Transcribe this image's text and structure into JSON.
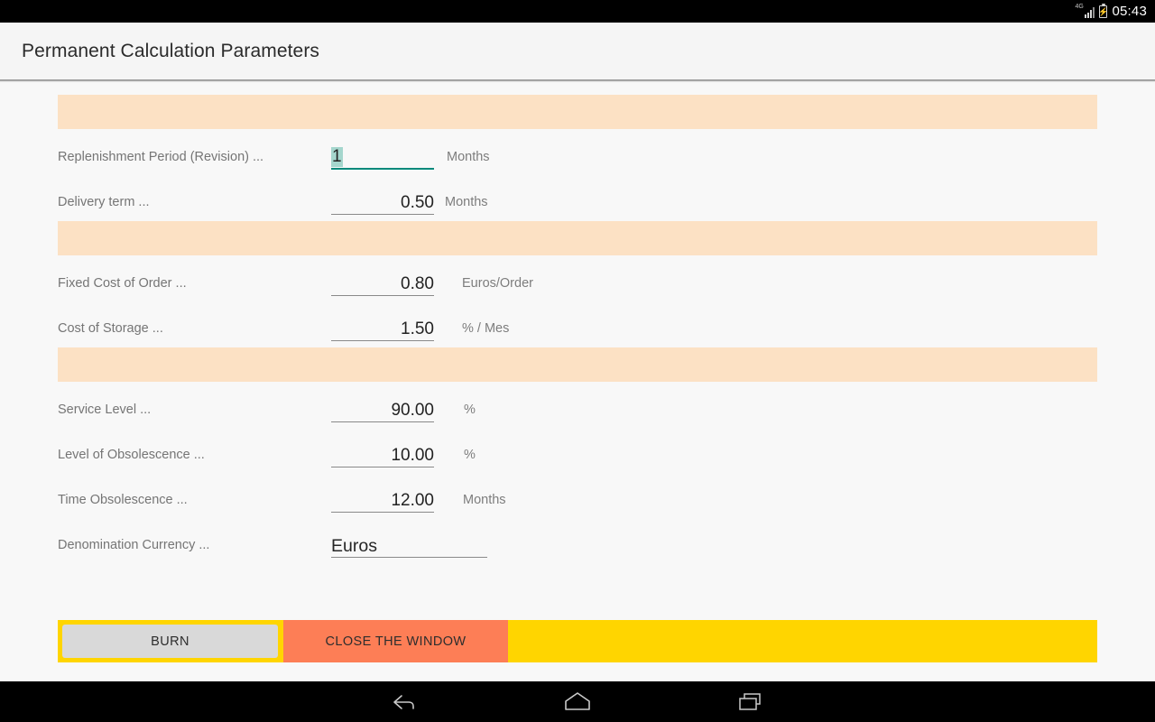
{
  "status_bar": {
    "network_label": "4G",
    "signal_icon": "signal-bars-icon",
    "battery_icon": "battery-charging-icon",
    "battery_glyph": "⚡",
    "clock": "05:43"
  },
  "app_bar": {
    "title": "Permanent Calculation Parameters"
  },
  "colors": {
    "band": "#FCE1C4",
    "accent_focus": "#00897B",
    "selection": "#A5D6CD",
    "button_bar": "#FFD500",
    "close_button": "#FD7E56",
    "burn_button": "#D9D9D9",
    "page_background": "#F8F8F8",
    "app_bar": "#F5F5F5"
  },
  "form": {
    "sections": [
      {
        "divider": true
      },
      {
        "rows": [
          {
            "label": "Replenishment Period (Revision) ...",
            "value": "1",
            "unit": "Months",
            "focused": true,
            "align": "left"
          },
          {
            "label": "Delivery term ...",
            "value": "0.50",
            "unit": "Months",
            "focused": false,
            "align": "right"
          }
        ]
      },
      {
        "divider": true
      },
      {
        "rows": [
          {
            "label": "Fixed Cost of Order ...",
            "value": "0.80",
            "unit": "Euros/Order",
            "focused": false,
            "align": "right"
          },
          {
            "label": "Cost of Storage ...",
            "value": "1.50",
            "unit": "% / Mes",
            "focused": false,
            "align": "right"
          }
        ]
      },
      {
        "divider": true
      },
      {
        "rows": [
          {
            "label": "Service Level ...",
            "value": "90.00",
            "unit": "%",
            "focused": false,
            "align": "right"
          },
          {
            "label": "Level of Obsolescence ...",
            "value": "10.00",
            "unit": "%",
            "focused": false,
            "align": "right"
          },
          {
            "label": "Time Obsolescence ...",
            "value": "12.00",
            "unit": "Months",
            "focused": false,
            "align": "right"
          },
          {
            "label": "Denomination Currency ...",
            "value": "Euros",
            "unit": "",
            "focused": false,
            "align": "left",
            "wide": true
          }
        ]
      }
    ]
  },
  "buttons": {
    "burn": "BURN",
    "close": "CLOSE THE WINDOW"
  },
  "nav_bar": {
    "back": "back-icon",
    "home": "home-icon",
    "recents": "recents-icon"
  }
}
